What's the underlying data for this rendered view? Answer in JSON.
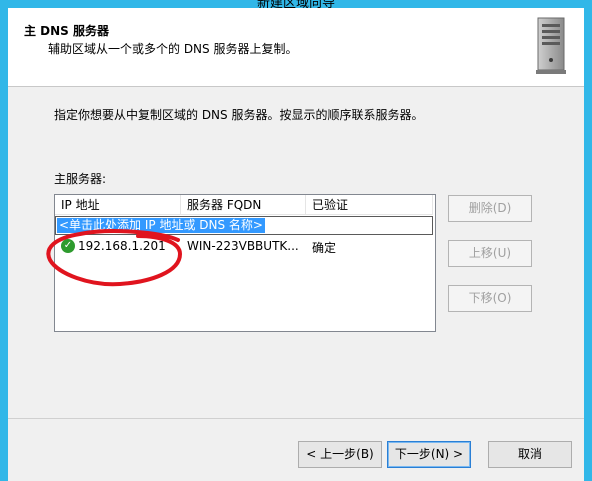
{
  "window": {
    "title": "新建区域向导"
  },
  "header": {
    "title": "主 DNS 服务器",
    "subtitle": "辅助区域从一个或多个的 DNS 服务器上复制。",
    "icon": "server-icon"
  },
  "main": {
    "instruction": "指定你想要从中复制区域的 DNS 服务器。按显示的顺序联系服务器。",
    "list_label": "主服务器:",
    "columns": [
      "IP 地址",
      "服务器 FQDN",
      "已验证"
    ],
    "edit_placeholder": "<单击此处添加 IP 地址或 DNS 名称>",
    "rows": [
      {
        "ip": "192.168.1.201",
        "fqdn": "WIN-223VBBUTK...",
        "verified": "确定",
        "status_icon": "check-icon"
      }
    ]
  },
  "side_buttons": {
    "delete": "删除(D)",
    "up": "上移(U)",
    "down": "下移(O)"
  },
  "footer": {
    "back": "< 上一步(B)",
    "next": "下一步(N) >",
    "cancel": "取消"
  },
  "colors": {
    "accent": "#31b7e8",
    "selection": "#3399ff",
    "annotation": "#e0141e"
  }
}
